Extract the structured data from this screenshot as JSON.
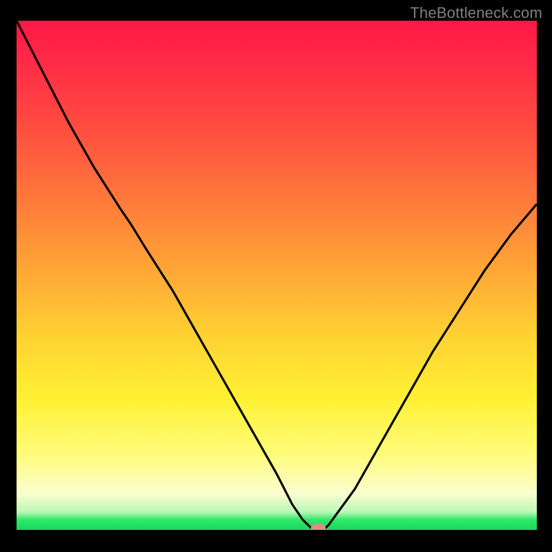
{
  "watermark": "TheBottleneck.com",
  "chart_data": {
    "type": "line",
    "title": "",
    "xlabel": "",
    "ylabel": "",
    "x": [
      0.0,
      0.05,
      0.1,
      0.15,
      0.2,
      0.22,
      0.25,
      0.3,
      0.35,
      0.4,
      0.45,
      0.5,
      0.53,
      0.55,
      0.57,
      0.59,
      0.6,
      0.65,
      0.7,
      0.75,
      0.8,
      0.85,
      0.9,
      0.95,
      1.0
    ],
    "y": [
      1.0,
      0.9,
      0.8,
      0.71,
      0.63,
      0.6,
      0.55,
      0.47,
      0.38,
      0.29,
      0.2,
      0.11,
      0.05,
      0.02,
      0.0,
      0.0,
      0.01,
      0.08,
      0.17,
      0.26,
      0.35,
      0.43,
      0.51,
      0.58,
      0.64
    ],
    "xlim": [
      0,
      1
    ],
    "ylim": [
      0,
      1
    ],
    "marker": {
      "x": 0.58,
      "y": 0.003,
      "color": "#df8d83"
    },
    "background_gradient": {
      "direction": "vertical",
      "stops": [
        {
          "pos": 0.0,
          "color": "#ff1846"
        },
        {
          "pos": 0.2,
          "color": "#ff4a40"
        },
        {
          "pos": 0.48,
          "color": "#ffa336"
        },
        {
          "pos": 0.74,
          "color": "#fff033"
        },
        {
          "pos": 0.93,
          "color": "#fafdd0"
        },
        {
          "pos": 0.98,
          "color": "#2fe96a"
        },
        {
          "pos": 1.0,
          "color": "#17d85e"
        }
      ]
    }
  }
}
